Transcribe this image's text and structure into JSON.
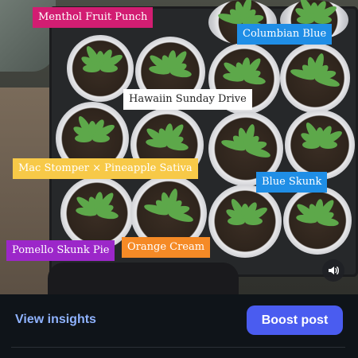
{
  "photo": {
    "labels": [
      {
        "text": "Menthol Fruit Punch",
        "bg": "#d21d72",
        "fg": "#ffffff"
      },
      {
        "text": "Columbian Blue",
        "bg": "#1f8ee6",
        "fg": "#ffffff"
      },
      {
        "text": "Hawaiin Sunday Drive",
        "bg": "#ffffff",
        "fg": "#222222"
      },
      {
        "text": "Mac Stomper × Pineapple Sativa",
        "bg": "#f7c948",
        "fg": "#ffffff"
      },
      {
        "text": "Blue Skunk",
        "bg": "#1f8ee6",
        "fg": "#ffffff"
      },
      {
        "text": "Pomello Skunk Pie",
        "bg": "#9c27c9",
        "fg": "#ffffff"
      },
      {
        "text": "Orange Cream",
        "bg": "#f58a26",
        "fg": "#ffffff"
      }
    ],
    "audio_icon": "speaker-icon"
  },
  "actions": {
    "insights_label": "View insights",
    "boost_label": "Boost post"
  },
  "colors": {
    "accent": "#4a5cf0",
    "link": "#8fb3ff",
    "background": "#0f1419"
  }
}
